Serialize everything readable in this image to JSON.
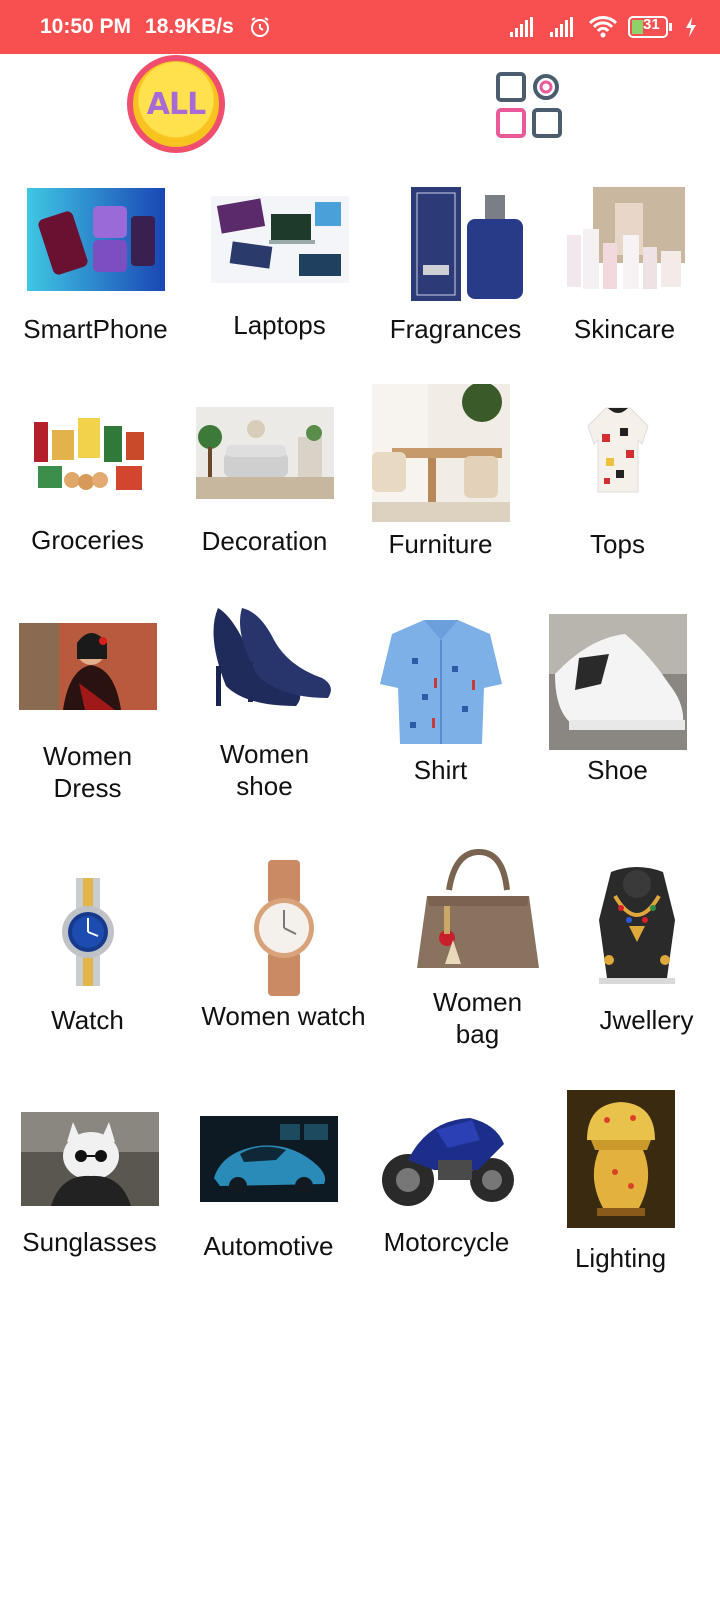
{
  "status_bar": {
    "time": "10:50 PM",
    "speed": "18.9KB/s",
    "battery": "31",
    "background_color": "#f85050"
  },
  "top_bar": {
    "all_label": "ALL",
    "grid_icon": "categories-grid-icon"
  },
  "categories": [
    {
      "label": "SmartPhone"
    },
    {
      "label": "Laptops"
    },
    {
      "label": "Fragrances"
    },
    {
      "label": "Skincare"
    },
    {
      "label": "Groceries"
    },
    {
      "label": "Decoration"
    },
    {
      "label": "Furniture"
    },
    {
      "label": "Tops"
    },
    {
      "label": "Women\nDress"
    },
    {
      "label": "Women\nshoe"
    },
    {
      "label": "Shirt"
    },
    {
      "label": "Shoe"
    },
    {
      "label": "Watch"
    },
    {
      "label": "Women watch"
    },
    {
      "label": "Women\nbag"
    },
    {
      "label": "Jwellery"
    },
    {
      "label": "Sunglasses"
    },
    {
      "label": "Automotive"
    },
    {
      "label": "Motorcycle"
    },
    {
      "label": "Lighting"
    }
  ]
}
